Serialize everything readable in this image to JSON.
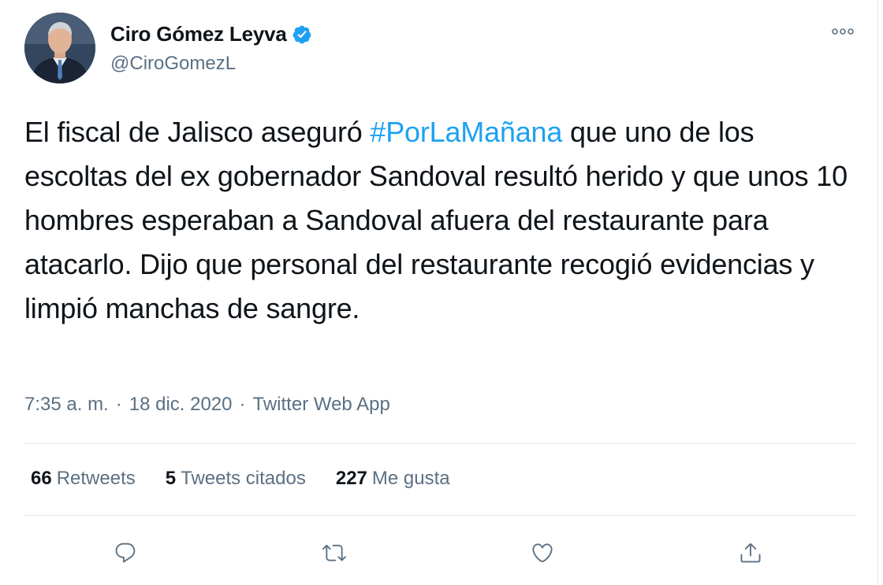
{
  "author": {
    "name": "Ciro Gómez Leyva",
    "handle": "@CiroGomezL",
    "verified": true
  },
  "tweet": {
    "text_before": "El fiscal de Jalisco aseguró ",
    "hashtag": "#PorLaMañana",
    "text_after": " que uno de los escoltas del ex gobernador Sandoval resultó herido y que unos 10 hombres esperaban a Sandoval afuera del restaurante para atacarlo. Dijo que personal del restaurante recogió evidencias y limpió manchas de sangre."
  },
  "meta": {
    "time": "7:35 a. m.",
    "separator": "·",
    "date": "18 dic. 2020",
    "source": "Twitter Web App"
  },
  "stats": {
    "retweets_count": "66",
    "retweets_label": "Retweets",
    "quotes_count": "5",
    "quotes_label": "Tweets citados",
    "likes_count": "227",
    "likes_label": "Me gusta"
  },
  "icons": {
    "more": "more-options-icon",
    "reply": "reply-icon",
    "retweet": "retweet-icon",
    "like": "like-icon",
    "share": "share-icon"
  },
  "colors": {
    "accent": "#1da1f2",
    "text": "#0f1419",
    "secondary": "#5b7083",
    "divider": "#e1e8ed"
  }
}
